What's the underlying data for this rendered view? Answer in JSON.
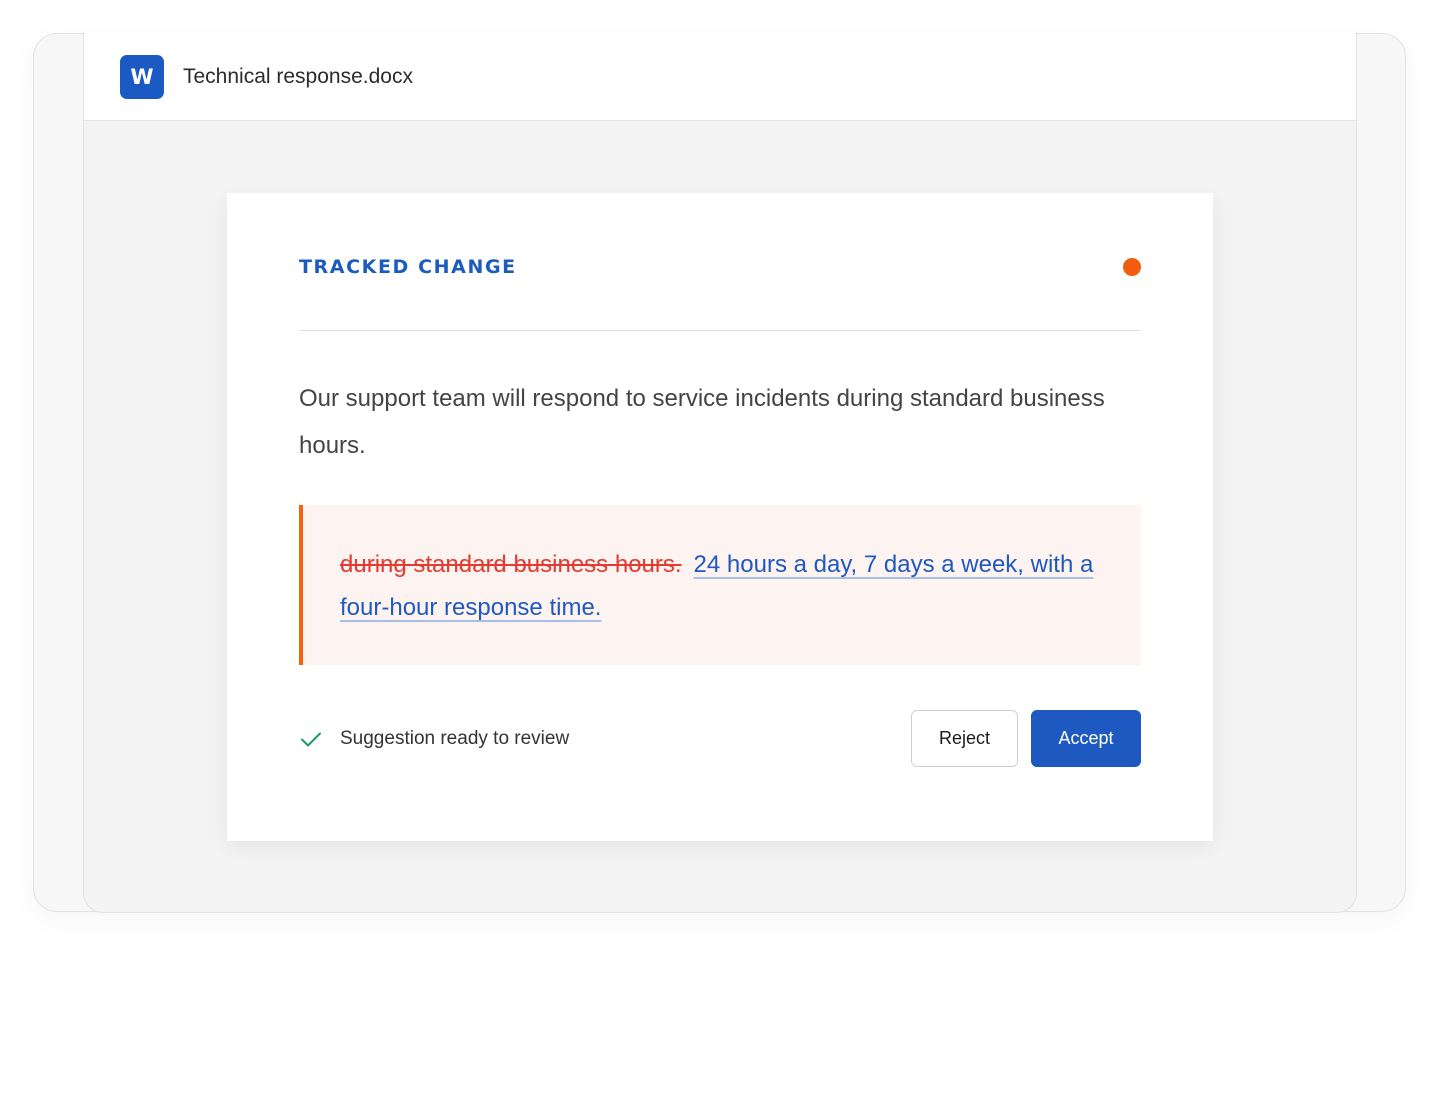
{
  "window": {
    "app_icon_letter": "W",
    "file_name": "Technical response.docx"
  },
  "card": {
    "label": "TRACKED CHANGE",
    "original_text": "Our support team will respond to service incidents during standard business hours.",
    "change": {
      "deleted": "during standard business hours.",
      "inserted": "24 hours a day, 7 days a week, with a four-hour response time."
    },
    "status": "Suggestion ready to review",
    "reject_label": "Reject",
    "accept_label": "Accept"
  },
  "colors": {
    "brand_blue": "#1d59c1",
    "status_dot": "#f25c0f",
    "deleted": "#e23b32",
    "inserted": "#2059c0",
    "check": "#1e9a63"
  },
  "icons": {
    "app": "word-icon",
    "status_dot": "status-dot",
    "status": "check-icon"
  }
}
